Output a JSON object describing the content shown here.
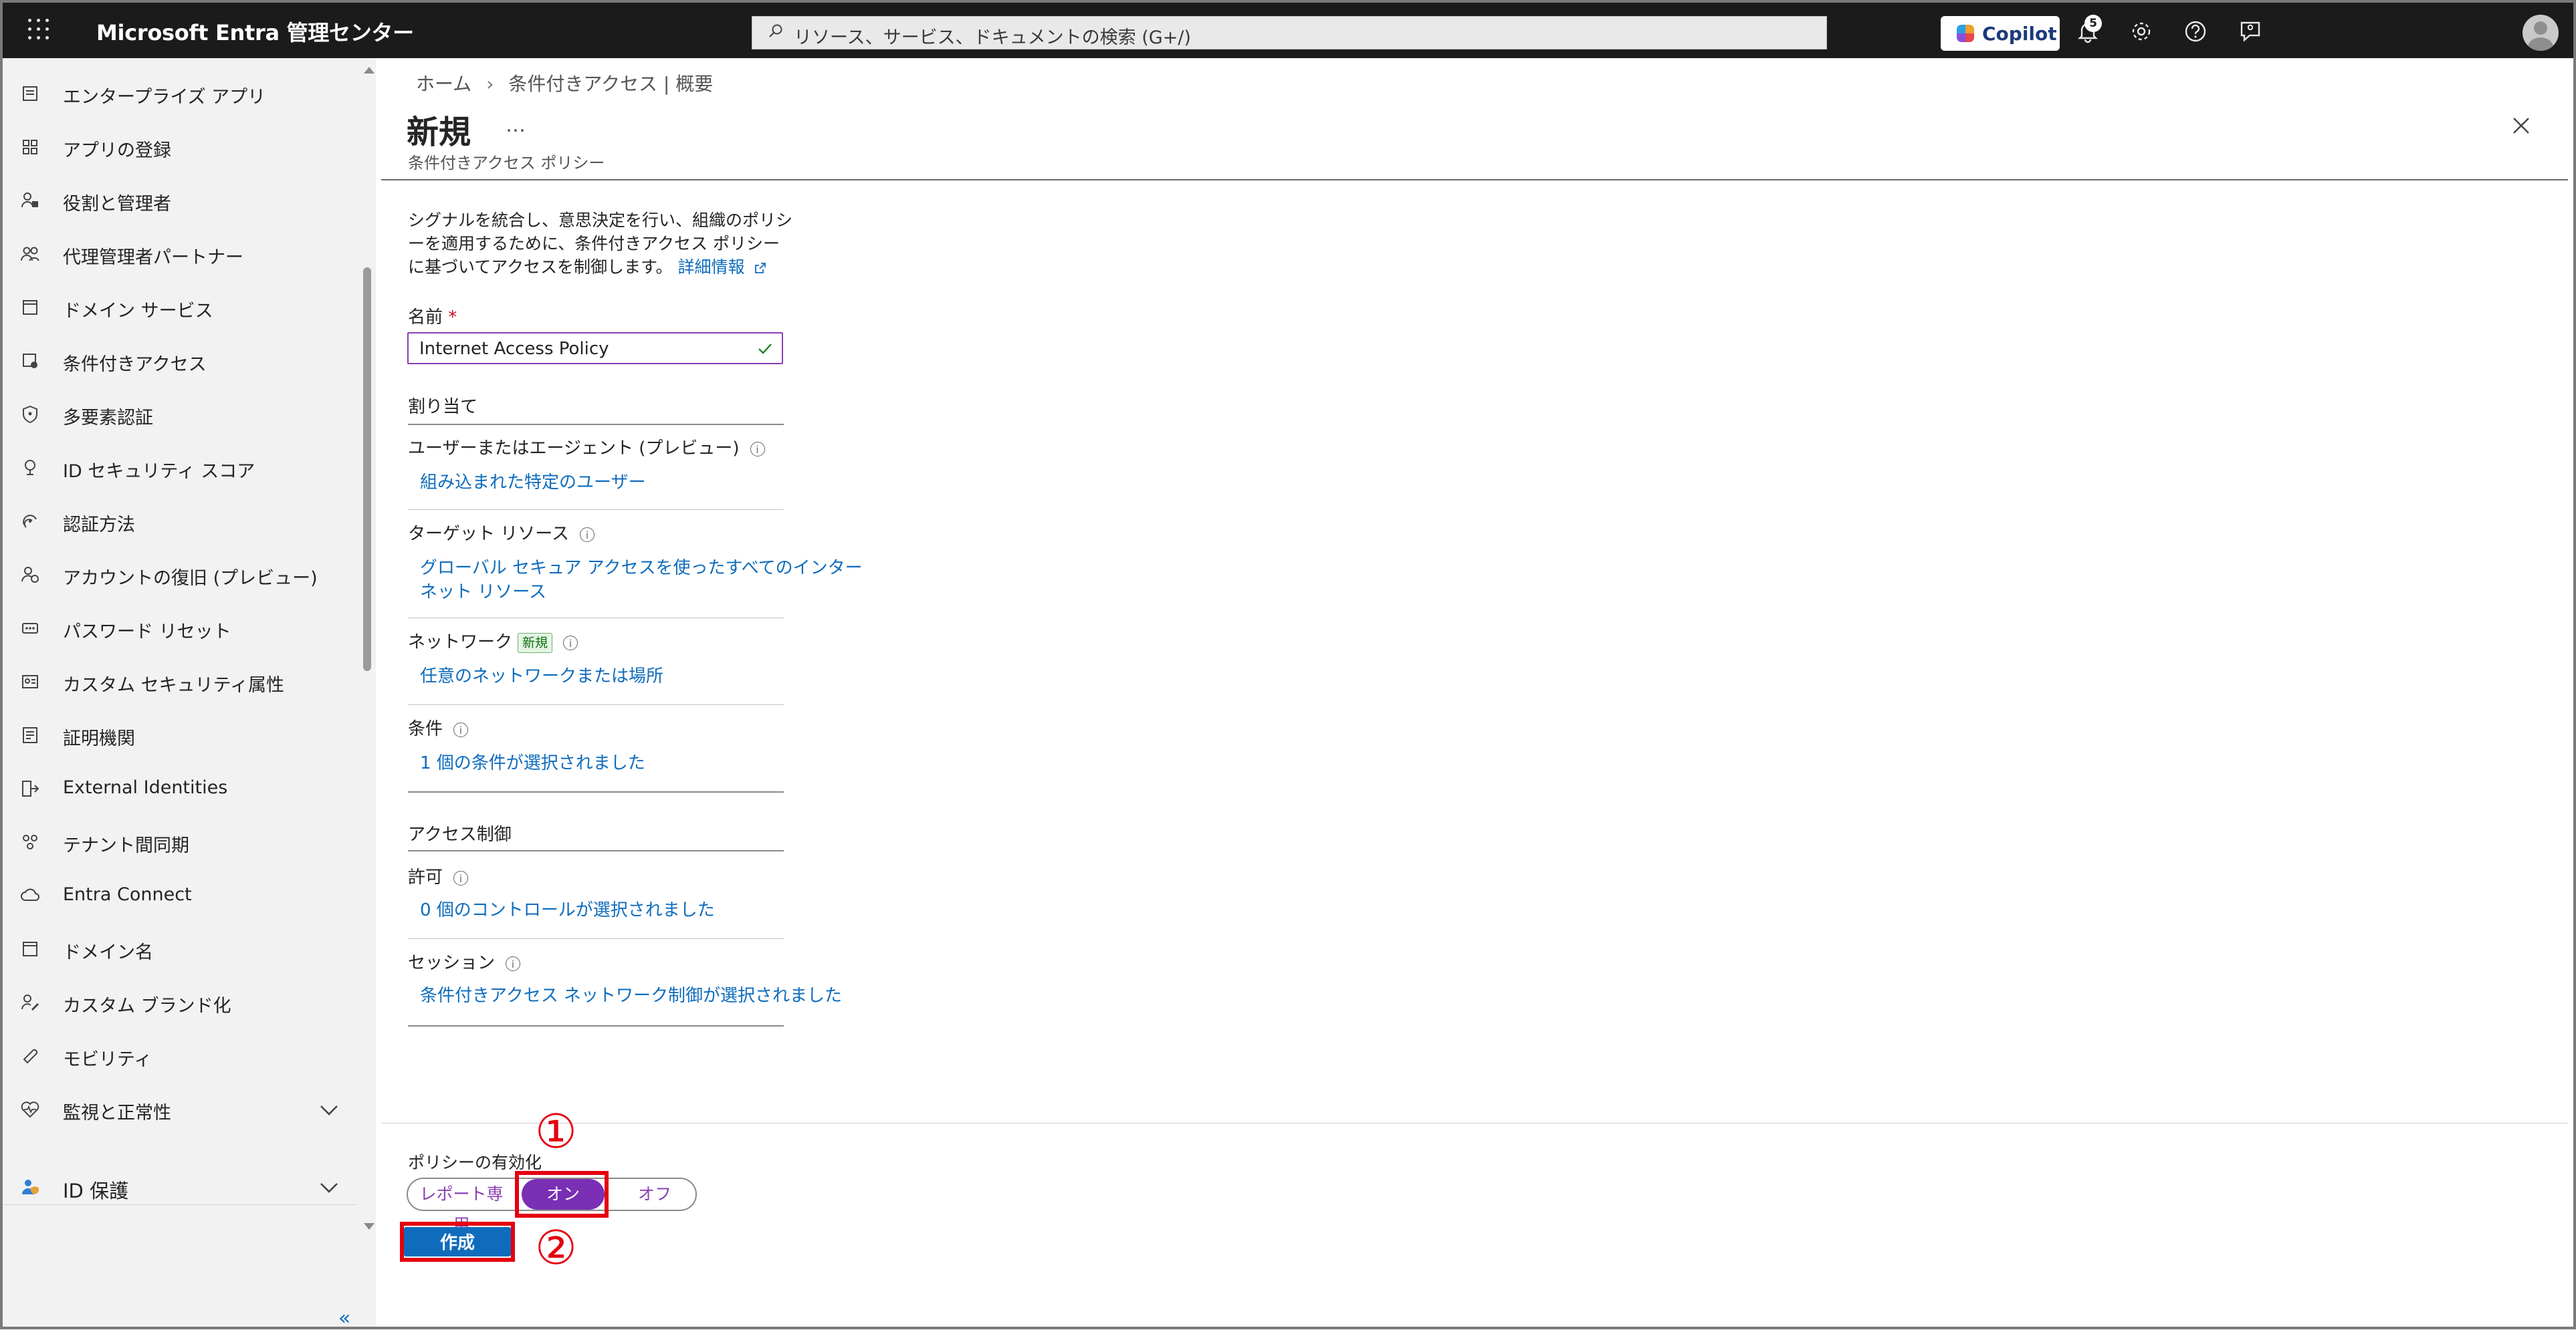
{
  "topbar": {
    "brand": "Microsoft Entra 管理センター",
    "search_placeholder": "リソース、サービス、ドキュメントの検索 (G+/)",
    "copilot_label": "Copilot",
    "notification_count": "5"
  },
  "sidebar": {
    "items": [
      {
        "label": "エンタープライズ アプリ",
        "icon": "enterprise-apps-icon"
      },
      {
        "label": "アプリの登録",
        "icon": "app-registration-icon"
      },
      {
        "label": "役割と管理者",
        "icon": "roles-icon"
      },
      {
        "label": "代理管理者パートナー",
        "icon": "delegated-admin-icon"
      },
      {
        "label": "ドメイン サービス",
        "icon": "domain-services-icon"
      },
      {
        "label": "条件付きアクセス",
        "icon": "conditional-access-icon"
      },
      {
        "label": "多要素認証",
        "icon": "mfa-shield-icon"
      },
      {
        "label": "ID セキュリティ スコア",
        "icon": "trophy-icon"
      },
      {
        "label": "認証方法",
        "icon": "auth-methods-icon"
      },
      {
        "label": "アカウントの復旧 (プレビュー)",
        "icon": "account-recovery-icon"
      },
      {
        "label": "パスワード リセット",
        "icon": "password-reset-icon"
      },
      {
        "label": "カスタム セキュリティ属性",
        "icon": "security-attributes-icon"
      },
      {
        "label": "証明機関",
        "icon": "certificate-icon"
      },
      {
        "label": "External Identities",
        "icon": "external-identities-icon"
      },
      {
        "label": "テナント間同期",
        "icon": "tenant-sync-icon"
      },
      {
        "label": "Entra Connect",
        "icon": "entra-connect-icon"
      },
      {
        "label": "ドメイン名",
        "icon": "domain-names-icon"
      },
      {
        "label": "カスタム ブランド化",
        "icon": "branding-icon"
      },
      {
        "label": "モビリティ",
        "icon": "mobility-icon"
      },
      {
        "label": "監視と正常性",
        "icon": "health-icon"
      }
    ],
    "section": {
      "label": "ID 保護",
      "icon": "id-protection-icon"
    },
    "collapse_label": "«"
  },
  "main": {
    "breadcrumb": [
      "ホーム",
      "条件付きアクセス | 概要"
    ],
    "breadcrumb_sep": "›",
    "title": "新規",
    "more": "…",
    "subtitle": "条件付きアクセス ポリシー",
    "description": "シグナルを統合し、意思決定を行い、組織のポリシーを適用するために、条件付きアクセス ポリシーに基づいてアクセスを制御します。",
    "learn_more": "詳細情報",
    "name_label": "名前",
    "required_mark": "*",
    "name_value": "Internet Access Policy",
    "assignments_heading": "割り当て",
    "users_label": "ユーザーまたはエージェント (プレビュー)",
    "users_link": "組み込まれた特定のユーザー",
    "target_label": "ターゲット リソース",
    "target_link_1": "グローバル セキュア アクセスを使ったすべてのインター",
    "target_link_2": "ネット リソース",
    "network_label": "ネットワーク",
    "network_new_tag": "新規",
    "network_link": "任意のネットワークまたは場所",
    "conditions_label": "条件",
    "conditions_link": "1 個の条件が選択されました",
    "access_controls_heading": "アクセス制御",
    "grant_label": "許可",
    "grant_link": "0 個のコントロールが選択されました",
    "session_label": "セッション",
    "session_link": "条件付きアクセス ネットワーク制御が選択されました"
  },
  "footer": {
    "enable_label": "ポリシーの有効化",
    "toggle_options": [
      "レポート専用",
      "オン",
      "オフ"
    ],
    "selected_option": "オン",
    "create_label": "作成"
  },
  "annotations": {
    "step1": "①",
    "step2": "②",
    "color": "#e4000f"
  },
  "colors": {
    "accent": "#0f6cbd",
    "toggle_active": "#7a2fb4",
    "topbar": "#1b1b1b"
  }
}
